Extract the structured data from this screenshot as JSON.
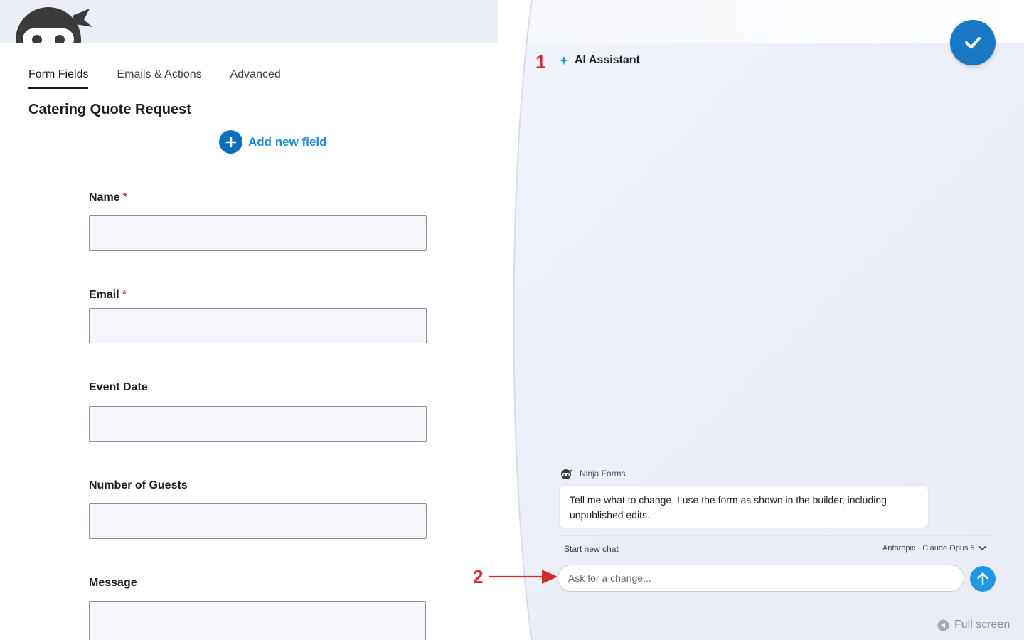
{
  "tabs": [
    {
      "label": "Form Fields"
    },
    {
      "label": "Emails & Actions"
    },
    {
      "label": "Advanced"
    }
  ],
  "form": {
    "title": "Catering Quote Request",
    "add_field_label": "Add new field",
    "required_marker": "*",
    "fields": [
      {
        "label": "Name",
        "required": true
      },
      {
        "label": "Email",
        "required": true
      },
      {
        "label": "Event Date",
        "required": false
      },
      {
        "label": "Number of Guests",
        "required": false
      },
      {
        "label": "Message",
        "required": false
      }
    ]
  },
  "assistant": {
    "title": "AI Assistant",
    "sender": "Ninja Forms",
    "message": "Tell me what to change. I use the form as shown in the builder, including unpublished edits.",
    "new_chat_label": "Start new chat",
    "model_label": "Anthropic · Claude Opus 5",
    "input_placeholder": "Ask for a change...",
    "fullscreen_label": "Full screen"
  },
  "annotations": {
    "one": "1",
    "two": "2"
  },
  "colors": {
    "accent_blue": "#1878c4",
    "link_blue": "#1f8ed6",
    "required_red": "#d63638",
    "annotation_red": "#d42a2a"
  },
  "icons": {
    "logo": "ninja-logo-icon",
    "save": "check-icon",
    "add": "plus-icon",
    "assistant": "sparkle-icon",
    "send": "arrow-up-icon",
    "fullscreen": "fullscreen-arrow-icon"
  }
}
